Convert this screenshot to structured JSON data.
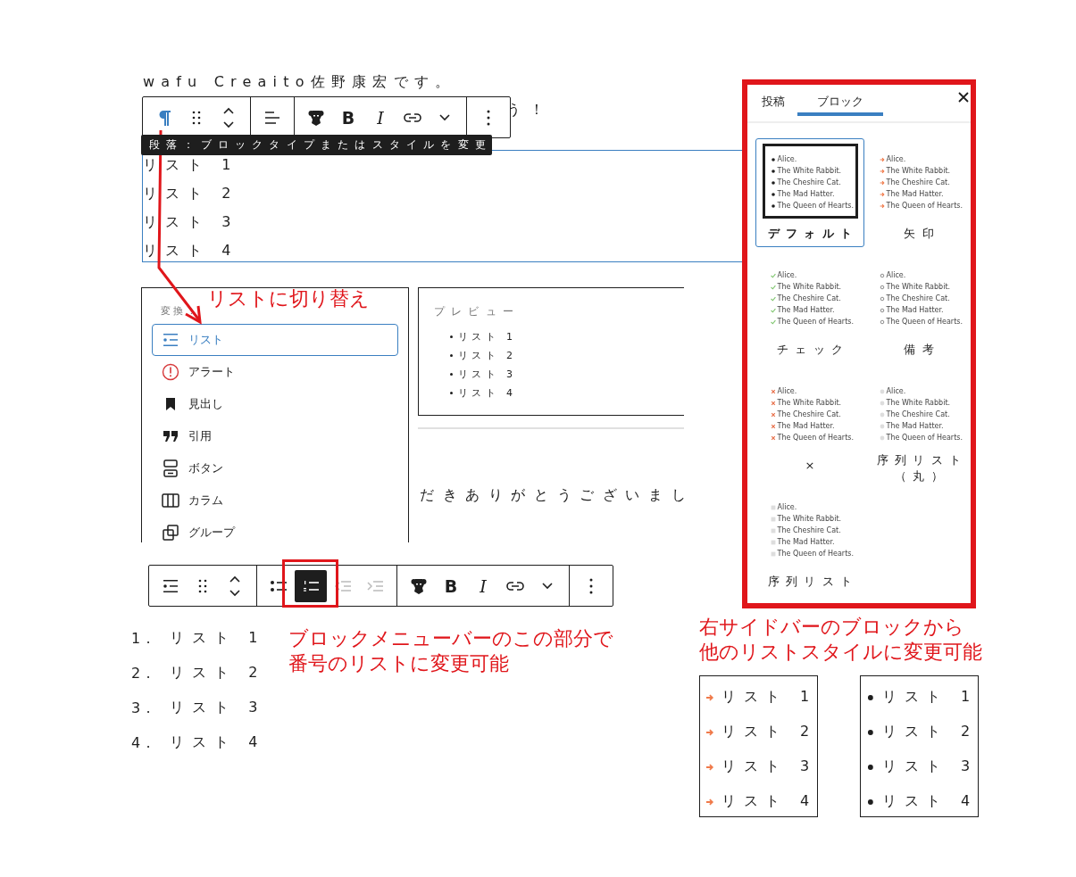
{
  "intro_text": "wafu Creaito佐野康宏です。",
  "intro_text_end": "う！",
  "top_toolbar": {
    "groups": [
      [
        {
          "kind": "pilcrow",
          "pressed": false,
          "disabled": false
        },
        {
          "kind": "drag",
          "pressed": false,
          "disabled": false
        },
        {
          "kind": "move",
          "pressed": false,
          "disabled": false
        }
      ],
      [
        {
          "kind": "align",
          "pressed": false,
          "disabled": false
        }
      ],
      [
        {
          "kind": "monkey",
          "pressed": false,
          "disabled": false
        },
        {
          "kind": "bold",
          "label": "B",
          "pressed": false,
          "disabled": false
        },
        {
          "kind": "italic",
          "label": "I",
          "pressed": false,
          "disabled": false
        },
        {
          "kind": "link",
          "pressed": false,
          "disabled": false
        },
        {
          "kind": "chevron",
          "pressed": false,
          "disabled": false
        }
      ],
      [
        {
          "kind": "more",
          "pressed": false,
          "disabled": false
        }
      ]
    ]
  },
  "tooltip": "段落：ブロックタイプまたはスタイルを変更",
  "paragraph_lines": [
    "リスト 1",
    "リスト 2",
    "リスト 3",
    "リスト 4"
  ],
  "transform_menu": {
    "title": "変換：",
    "items": [
      {
        "kind": "list",
        "label": "リスト",
        "selected": true
      },
      {
        "kind": "alert",
        "label": "アラート",
        "selected": false
      },
      {
        "kind": "heading",
        "label": "見出し",
        "selected": false
      },
      {
        "kind": "quote",
        "label": "引用",
        "selected": false
      },
      {
        "kind": "buttons",
        "label": "ボタン",
        "selected": false
      },
      {
        "kind": "columns",
        "label": "カラム",
        "selected": false
      },
      {
        "kind": "group",
        "label": "グループ",
        "selected": false
      }
    ]
  },
  "preview": {
    "title": "プレビュー",
    "items": [
      "リスト 1",
      "リスト 2",
      "リスト 3",
      "リスト 4"
    ]
  },
  "trailing_text": "だきありがとうございまし",
  "annotation_switch": "リストに切り替え",
  "bottom_toolbar": {
    "groups": [
      [
        {
          "kind": "list",
          "pressed": false,
          "disabled": false
        },
        {
          "kind": "drag",
          "pressed": false,
          "disabled": false
        },
        {
          "kind": "move",
          "pressed": false,
          "disabled": false
        }
      ],
      [
        {
          "kind": "bullets",
          "pressed": false,
          "disabled": false
        },
        {
          "kind": "numbered",
          "pressed": true,
          "disabled": false
        },
        {
          "kind": "outdent",
          "pressed": false,
          "disabled": true
        },
        {
          "kind": "indent",
          "pressed": false,
          "disabled": true
        }
      ],
      [
        {
          "kind": "monkey",
          "pressed": false,
          "disabled": false
        },
        {
          "kind": "bold",
          "label": "B",
          "pressed": false,
          "disabled": false
        },
        {
          "kind": "italic",
          "label": "I",
          "pressed": false,
          "disabled": false
        },
        {
          "kind": "link",
          "pressed": false,
          "disabled": false
        },
        {
          "kind": "chevron",
          "pressed": false,
          "disabled": false
        }
      ],
      [
        {
          "kind": "more",
          "pressed": false,
          "disabled": false
        }
      ]
    ]
  },
  "numbered_list": [
    {
      "number": "1.",
      "text": "リスト 1"
    },
    {
      "number": "2.",
      "text": "リスト 2"
    },
    {
      "number": "3.",
      "text": "リスト 3"
    },
    {
      "number": "4.",
      "text": "リスト 4"
    }
  ],
  "annotation_toolbar": [
    "ブロックメニューバーのこの部分で",
    "番号のリストに変更可能"
  ],
  "sidebar": {
    "tabs": [
      {
        "label": "投稿",
        "selected": false
      },
      {
        "label": "ブロック",
        "selected": true
      }
    ],
    "styles": [
      {
        "label": "デフォルト",
        "kind": "dot",
        "selected": true,
        "preview": [
          "Alice.",
          "The White Rabbit.",
          "The Cheshire Cat.",
          "The Mad Hatter.",
          "The Queen of Hearts."
        ]
      },
      {
        "label": "矢印",
        "kind": "arrow",
        "selected": false,
        "preview": [
          "Alice.",
          "The White Rabbit.",
          "The Cheshire Cat.",
          "The Mad Hatter.",
          "The Queen of Hearts."
        ]
      },
      {
        "label": "チェック",
        "kind": "check",
        "selected": false,
        "preview": [
          "Alice.",
          "The White Rabbit.",
          "The Cheshire Cat.",
          "The Mad Hatter.",
          "The Queen of Hearts."
        ]
      },
      {
        "label": "備考",
        "kind": "note",
        "selected": false,
        "preview": [
          "Alice.",
          "The White Rabbit.",
          "The Cheshire Cat.",
          "The Mad Hatter.",
          "The Queen of Hearts."
        ]
      },
      {
        "label": "×",
        "kind": "cross",
        "selected": false,
        "preview": [
          "Alice.",
          "The White Rabbit.",
          "The Cheshire Cat.",
          "The Mad Hatter.",
          "The Queen of Hearts."
        ]
      },
      {
        "label": "序列リスト（丸）",
        "kind": "circled",
        "selected": false,
        "preview": [
          "Alice.",
          "The White Rabbit.",
          "The Cheshire Cat.",
          "The Mad Hatter.",
          "The Queen of Hearts."
        ]
      },
      {
        "label": "序列リスト",
        "kind": "squared",
        "selected": false,
        "preview": [
          "Alice.",
          "The White Rabbit.",
          "The Cheshire Cat.",
          "The Mad Hatter.",
          "The Queen of Hearts."
        ]
      }
    ]
  },
  "annotation_sidebar": [
    "右サイドバーのブロックから",
    "他のリストスタイルに変更可能"
  ],
  "arrow_list": {
    "kind": "arrow",
    "items": [
      "リスト 1",
      "リスト 2",
      "リスト 3",
      "リスト 4"
    ]
  },
  "bullet_list": {
    "kind": "dot",
    "items": [
      "リスト 1",
      "リスト 2",
      "リスト 3",
      "リスト 4"
    ]
  }
}
